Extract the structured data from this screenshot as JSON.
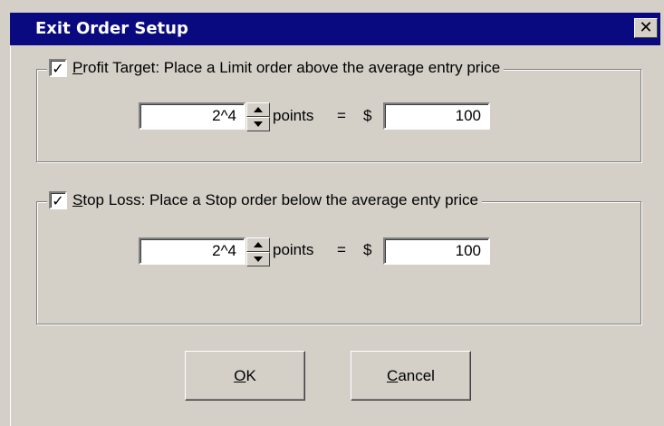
{
  "dialog": {
    "title": "Exit Order Setup",
    "close_glyph": "✕"
  },
  "profit_target": {
    "checked": true,
    "label_accel": "P",
    "label_rest": "rofit Target: Place a Limit order above the average entry price",
    "points_value": "2^4",
    "points_label": "points",
    "equals": "=",
    "currency": "$",
    "dollar_value": "100"
  },
  "stop_loss": {
    "checked": true,
    "label_accel": "S",
    "label_rest": "top Loss: Place a Stop order below the average enty price",
    "points_value": "2^4",
    "points_label": "points",
    "equals": "=",
    "currency": "$",
    "dollar_value": "100"
  },
  "buttons": {
    "ok_accel": "O",
    "ok_rest": "K",
    "cancel_accel": "C",
    "cancel_rest": "ancel"
  },
  "icons": {
    "checkbox_check": "check-icon",
    "close": "close-icon",
    "spin_up": "arrow-up-icon",
    "spin_down": "arrow-down-icon"
  }
}
